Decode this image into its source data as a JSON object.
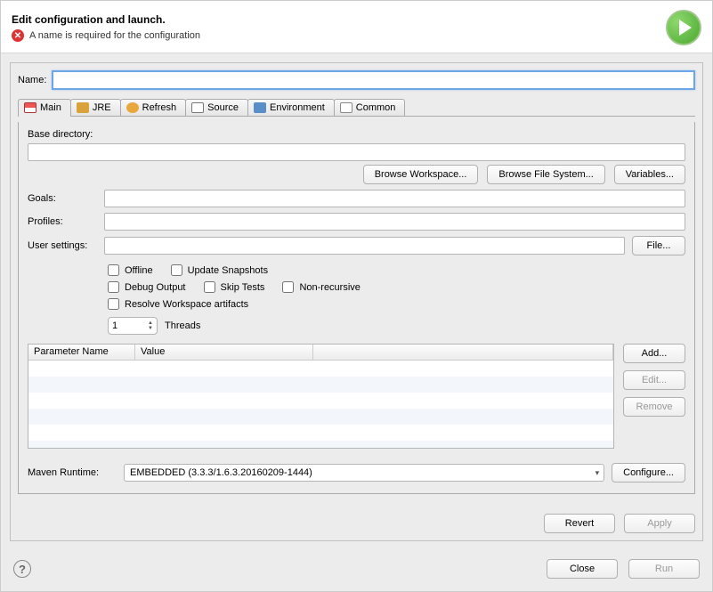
{
  "header": {
    "title": "Edit configuration and launch.",
    "error": "A name is required for the configuration"
  },
  "name": {
    "label": "Name:",
    "value": ""
  },
  "tabs": [
    {
      "id": "main",
      "label": "Main"
    },
    {
      "id": "jre",
      "label": "JRE"
    },
    {
      "id": "refresh",
      "label": "Refresh"
    },
    {
      "id": "source",
      "label": "Source"
    },
    {
      "id": "environment",
      "label": "Environment"
    },
    {
      "id": "common",
      "label": "Common"
    }
  ],
  "main_tab": {
    "base_directory_label": "Base directory:",
    "base_directory_value": "",
    "browse_workspace": "Browse Workspace...",
    "browse_filesystem": "Browse File System...",
    "variables": "Variables...",
    "goals_label": "Goals:",
    "goals_value": "",
    "profiles_label": "Profiles:",
    "profiles_value": "",
    "user_settings_label": "User settings:",
    "user_settings_value": "",
    "file_button": "File...",
    "checkboxes": {
      "offline": "Offline",
      "update_snapshots": "Update Snapshots",
      "debug_output": "Debug Output",
      "skip_tests": "Skip Tests",
      "non_recursive": "Non-recursive",
      "resolve_workspace": "Resolve Workspace artifacts"
    },
    "threads_value": "1",
    "threads_label": "Threads",
    "table": {
      "col_name": "Parameter Name",
      "col_value": "Value",
      "add": "Add...",
      "edit": "Edit...",
      "remove": "Remove"
    },
    "runtime_label": "Maven Runtime:",
    "runtime_value": "EMBEDDED (3.3.3/1.6.3.20160209-1444)",
    "configure": "Configure..."
  },
  "panel_buttons": {
    "revert": "Revert",
    "apply": "Apply"
  },
  "footer": {
    "close": "Close",
    "run": "Run"
  }
}
